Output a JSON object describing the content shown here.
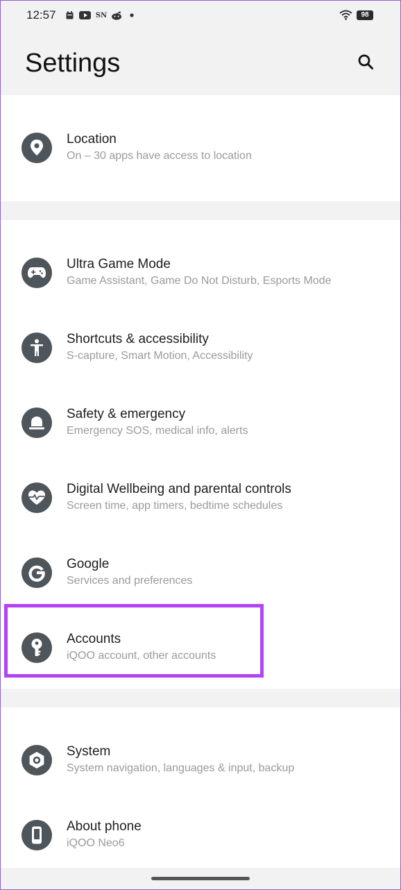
{
  "status_bar": {
    "time": "12:57",
    "battery": "98",
    "notification_icons": [
      "calendar-icon",
      "youtube-icon",
      "sn-app-icon",
      "reddit-icon",
      "more-dot-icon"
    ]
  },
  "header": {
    "title": "Settings",
    "search_icon": "search-icon"
  },
  "settings": {
    "location": {
      "label": "Location",
      "subtitle": "On – 30 apps have access to location",
      "icon": "location-pin-icon"
    },
    "ultra_game_mode": {
      "label": "Ultra Game Mode",
      "subtitle": "Game Assistant, Game Do Not Disturb, Esports Mode",
      "icon": "gamepad-icon"
    },
    "shortcuts": {
      "label": "Shortcuts & accessibility",
      "subtitle": "S-capture, Smart Motion, Accessibility",
      "icon": "accessibility-icon"
    },
    "safety": {
      "label": "Safety & emergency",
      "subtitle": "Emergency SOS, medical info, alerts",
      "icon": "emergency-light-icon"
    },
    "wellbeing": {
      "label": "Digital Wellbeing and parental controls",
      "subtitle": "Screen time, app timers, bedtime schedules",
      "icon": "heart-icon"
    },
    "google": {
      "label": "Google",
      "subtitle": "Services and preferences",
      "icon": "google-icon"
    },
    "accounts": {
      "label": "Accounts",
      "subtitle": "iQOO account, other accounts",
      "icon": "key-icon"
    },
    "system": {
      "label": "System",
      "subtitle": "System navigation, languages & input, backup",
      "icon": "system-gear-icon"
    },
    "about": {
      "label": "About phone",
      "subtitle": "iQOO Neo6",
      "icon": "phone-icon"
    }
  },
  "colors": {
    "highlight": "#b144f5",
    "icon_background": "#4e555b",
    "page_background": "#f2f2f2"
  }
}
